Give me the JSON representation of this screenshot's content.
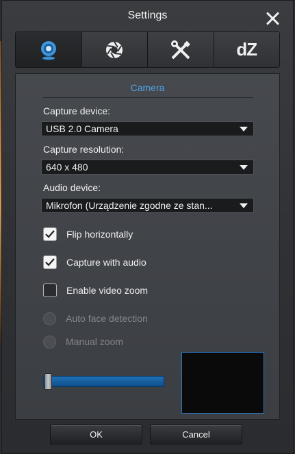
{
  "window": {
    "title": "Settings"
  },
  "tabs": [
    {
      "id": "webcam",
      "icon": "webcam-icon",
      "active": true
    },
    {
      "id": "effects",
      "icon": "aperture-icon",
      "active": false
    },
    {
      "id": "tools",
      "icon": "wrench-screwdriver-icon",
      "active": false
    },
    {
      "id": "dz",
      "label": "dZ",
      "active": false
    }
  ],
  "camera": {
    "section_title": "Camera",
    "capture_device_label": "Capture device:",
    "capture_device_value": "USB 2.0 Camera",
    "capture_resolution_label": "Capture resolution:",
    "capture_resolution_value": "640 x 480",
    "audio_device_label": "Audio device:",
    "audio_device_value": "Mikrofon (Urządzenie zgodne ze stan..."
  },
  "options": {
    "flip_horizontally": {
      "label": "Flip horizontally",
      "checked": true
    },
    "capture_with_audio": {
      "label": "Capture with audio",
      "checked": true
    },
    "enable_video_zoom": {
      "label": "Enable video zoom",
      "checked": false
    },
    "auto_face_detection": {
      "label": "Auto face detection",
      "enabled": false
    },
    "manual_zoom": {
      "label": "Manual zoom",
      "enabled": false
    }
  },
  "zoom": {
    "level": 0
  },
  "buttons": {
    "ok": "OK",
    "cancel": "Cancel"
  },
  "colors": {
    "accent": "#4ea3e6",
    "slider": "#1f6fb5"
  }
}
